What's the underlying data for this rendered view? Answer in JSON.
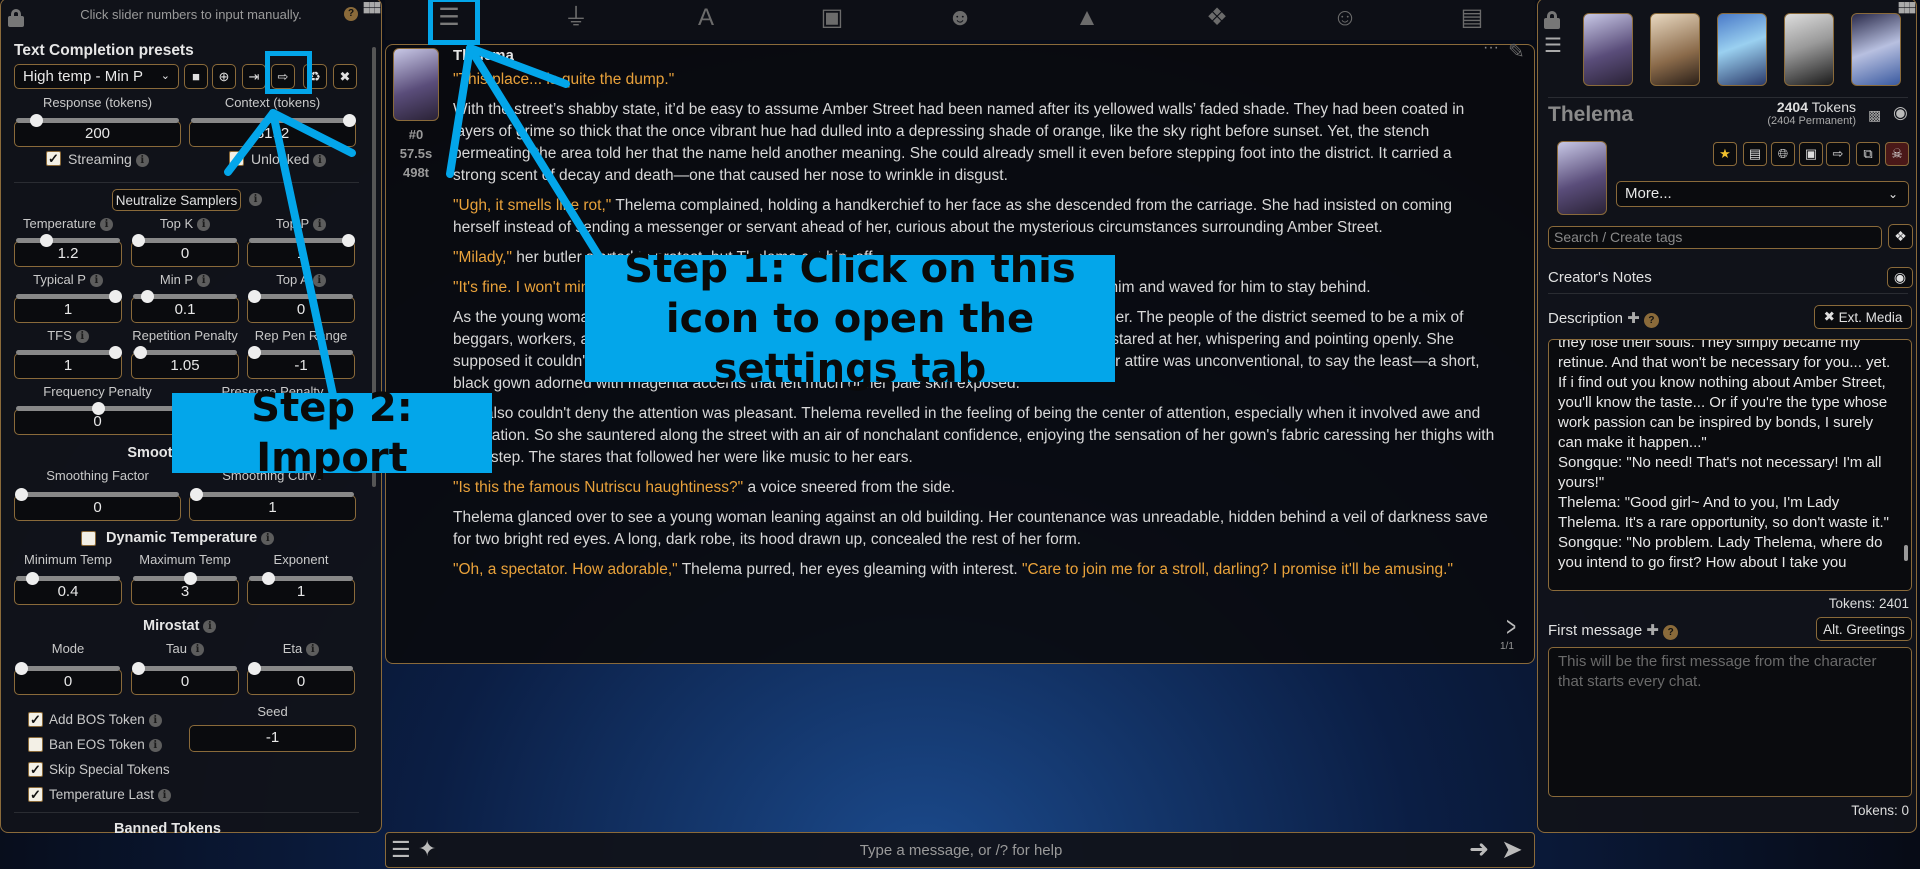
{
  "nav": {
    "icons": [
      "sliders-icon",
      "plug-icon",
      "font-icon",
      "book-globe-icon",
      "user-gear-icon",
      "image-icon",
      "cubes-icon",
      "smiley-icon",
      "id-card-icon"
    ],
    "active": "sliders-icon"
  },
  "left": {
    "hint": "Click slider numbers to input manually.",
    "title": "Text Completion presets",
    "preset": "High temp - Min P",
    "preset_buttons": [
      "save-icon",
      "new-file-icon",
      "import-icon",
      "export-icon",
      "restore-icon",
      "trash-icon"
    ],
    "response": {
      "label": "Response (tokens)",
      "value": "200",
      "level": 0.1
    },
    "context": {
      "label": "Context (tokens)",
      "value": "8192",
      "level": 1
    },
    "streaming": {
      "label": "Streaming",
      "checked": true
    },
    "unlocked": {
      "label": "Unlocked",
      "checked": false
    },
    "neutralize": "Neutralize Samplers",
    "samplers": [
      {
        "label": "Temperature",
        "value": "1.2",
        "level": 0.27,
        "info": true
      },
      {
        "label": "Top K",
        "value": "0",
        "level": 0,
        "info": true
      },
      {
        "label": "Top P",
        "value": "1",
        "level": 1,
        "info": true
      },
      {
        "label": "Typical P",
        "value": "1",
        "level": 1,
        "info": true
      },
      {
        "label": "Min P",
        "value": "0.1",
        "level": 0.1,
        "info": true
      },
      {
        "label": "Top A",
        "value": "0",
        "level": 0,
        "info": true
      },
      {
        "label": "TFS",
        "value": "1",
        "level": 1,
        "info": true
      },
      {
        "label": "Repetition Penalty",
        "value": "1.05",
        "level": 0.02,
        "info": false
      },
      {
        "label": "Rep Pen Range",
        "value": "-1",
        "level": 0,
        "info": false
      }
    ],
    "penalties": [
      {
        "label": "Frequency Penalty",
        "value": "0",
        "level": 0.5
      },
      {
        "label": "Presence Penalty",
        "value": "0",
        "level": 0.5
      }
    ],
    "smooth_title": "Smooth Sampling",
    "smooth": [
      {
        "label": "Smoothing Factor",
        "value": "0",
        "level": 0
      },
      {
        "label": "Smoothing Curve",
        "value": "1",
        "level": 0
      }
    ],
    "dyn_title": "Dynamic Temperature",
    "dyn_checked": false,
    "dyn": [
      {
        "label": "Minimum Temp",
        "value": "0.4",
        "level": 0.12
      },
      {
        "label": "Maximum Temp",
        "value": "3",
        "level": 0.55
      },
      {
        "label": "Exponent",
        "value": "1",
        "level": 0.15
      }
    ],
    "miro_title": "Mirostat",
    "miro": [
      {
        "label": "Mode",
        "value": "0",
        "level": 0,
        "info": false
      },
      {
        "label": "Tau",
        "value": "0",
        "level": 0,
        "info": true
      },
      {
        "label": "Eta",
        "value": "0",
        "level": 0,
        "info": true
      }
    ],
    "checks": [
      {
        "label": "Add BOS Token",
        "checked": true,
        "info": true
      },
      {
        "label": "Ban EOS Token",
        "checked": false,
        "info": true
      },
      {
        "label": "Skip Special Tokens",
        "checked": true,
        "info": false
      },
      {
        "label": "Temperature Last",
        "checked": true,
        "info": true
      }
    ],
    "seed": {
      "label": "Seed",
      "value": "-1"
    },
    "banned": "Banned Tokens"
  },
  "chat": {
    "name": "Thelema",
    "meta": [
      "#0",
      "57.5s",
      "498t"
    ],
    "swipe": "1/1",
    "paragraphs": [
      [
        {
          "t": "\"This place... is quite the dump.\"",
          "q": true
        }
      ],
      [
        {
          "t": "With the street’s shabby state, it’d be easy to assume Amber Street had been named after its yellowed walls’ faded shade. They had been coated in layers of grime so thick that the once vibrant hue had dulled into a depressing shade of orange, like the sky right before sunset. Yet, the stench permeating the area told her that the name held another meaning. She could already smell it even before stepping foot into the district. It carried a strong scent of decay and death—one that caused her nose to wrinkle in disgust.",
          "q": false
        }
      ],
      [
        {
          "t": "\"Ugh, it smells like rot,\"",
          "q": true
        },
        {
          "t": " Thelema complained, holding a handkerchief to her face as she descended from the carriage. She had insisted on coming herself instead of sending a messenger or servant ahead of her, curious about the mysterious circumstances surrounding Amber Street.",
          "q": false
        }
      ],
      [
        {
          "t": "\"Milady,\"",
          "q": true
        },
        {
          "t": " her butler started to protest, but Thelema cut him off.",
          "q": false
        }
      ],
      [
        {
          "t": "\"It's fine. I won't mind.\"",
          "q": true
        },
        {
          "t": " With a flourish and the swish of her gown's fabric, she turned away from him and waved for him to stay behind.",
          "q": false
        }
      ],
      [
        {
          "t": "As the young woman strolled down the street, she ignored the curious looks the denizens gave her. The people of the district seemed to be a mix of beggars, workers, and families trying to make a decent living, and everything in between. Some stared at her, whispering and pointing openly. She supposed it couldn't be helped, considering how little she resembled the typical noblewoman. Her attire was unconventional, to say the least—a short, black gown adorned with magenta accents that left much of her pale skin exposed.",
          "q": false
        }
      ],
      [
        {
          "t": "She also couldn't deny the attention was pleasant. Thelema revelled in the feeling of being the center of attention, especially when it involved awe and admiration. So she sauntered along the street with an air of nonchalant confidence, enjoying the sensation of her gown's fabric caressing her thighs with each step. The stares that followed her were like music to her ears.",
          "q": false
        }
      ],
      [
        {
          "t": "\"Is this the famous Nutriscu haughtiness?\"",
          "q": true
        },
        {
          "t": " a voice sneered from the side.",
          "q": false
        }
      ],
      [
        {
          "t": "Thelema glanced over to see a young woman leaning against an old building. Her countenance was unreadable, hidden behind a veil of darkness save for two bright red eyes. A long, dark robe, its hood drawn up, concealed the rest of her form.",
          "q": false
        }
      ],
      [
        {
          "t": "\"Oh, a spectator. How adorable,\"",
          "q": true
        },
        {
          "t": " Thelema purred, her eyes gleaming with interest. ",
          "q": false
        },
        {
          "t": "\"Care to join me for a stroll, darling? I promise it'll be amusing.\"",
          "q": true
        }
      ]
    ],
    "input_placeholder": "Type a message, or /? for help"
  },
  "right": {
    "name": "Thelema",
    "tokens": "2404",
    "tokens_label": "Tokens",
    "permanent": "(2404 Permanent)",
    "more": "More...",
    "tags_placeholder": "Search / Create tags",
    "creators_notes": "Creator's Notes",
    "description_label": "Description",
    "ext_media": "Ext. Media",
    "description": "they lose their souls. They simply became my retinue. And that won't be necessary for you... yet. If i find out you know nothing about Amber Street, you'll know the taste... Or if you're the type whose work passion can be inspired by bonds, I surely can make it happen...\"\nSongque: \"No need! That's not necessary! I'm all yours!\"\nThelema: \"Good girl~ And to you, I'm Lady Thelema. It's a rare opportunity, so don't waste it.\"\nSongque: \"No problem. Lady Thelema, where do you intend to go first? How about I take you",
    "desc_tokens": "Tokens: 2401",
    "first_message_label": "First message",
    "alt_greetings": "Alt. Greetings",
    "first_message_placeholder": "This will be the first message from the character that starts every chat.",
    "fm_tokens": "Tokens: 0"
  },
  "overlay": {
    "step1": "Step 1: Click on this icon to open the settings tab",
    "step2": "Step 2: Import",
    "color": "#03a6ea"
  }
}
